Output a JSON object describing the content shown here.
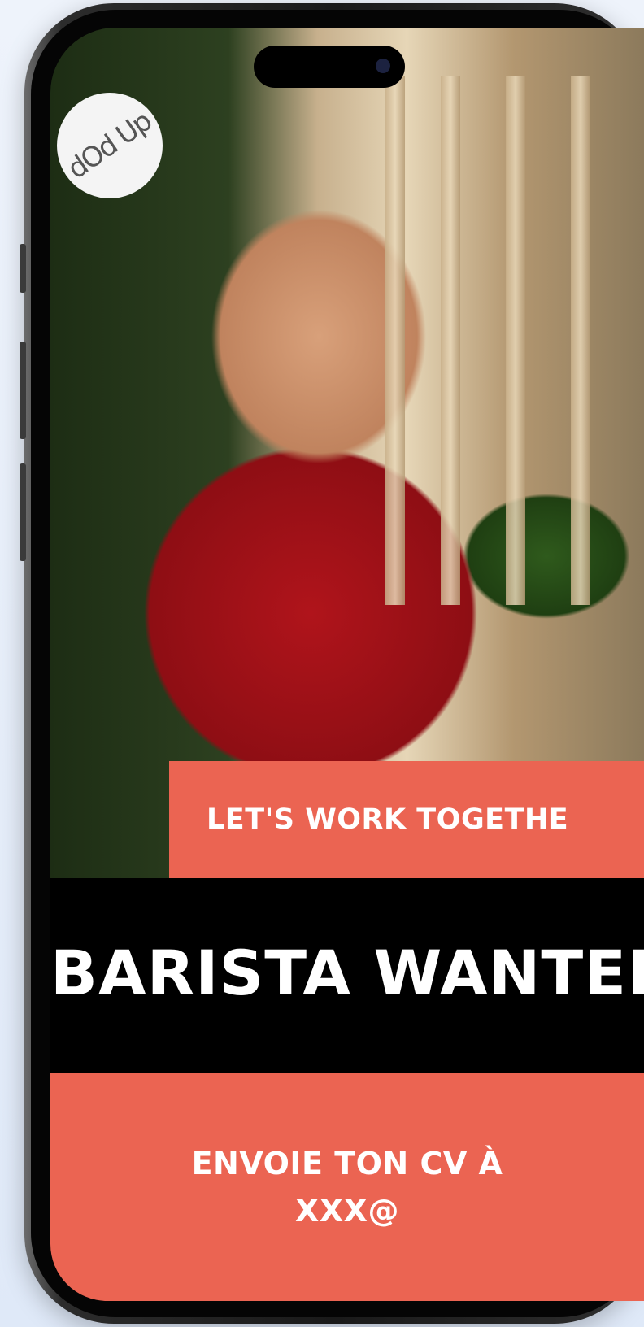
{
  "poster": {
    "logo_text": "dOd Up",
    "tagline": "LET'S WORK TOGETHE",
    "headline": "BARISTA WANTED",
    "cta_line1": "ENVOIE TON CV À",
    "cta_line2": "XXX@"
  },
  "colors": {
    "accent": "#eb6452",
    "band": "#000000",
    "text": "#ffffff"
  },
  "icons": [
    "logo-badge-icon",
    "camera-icon"
  ]
}
